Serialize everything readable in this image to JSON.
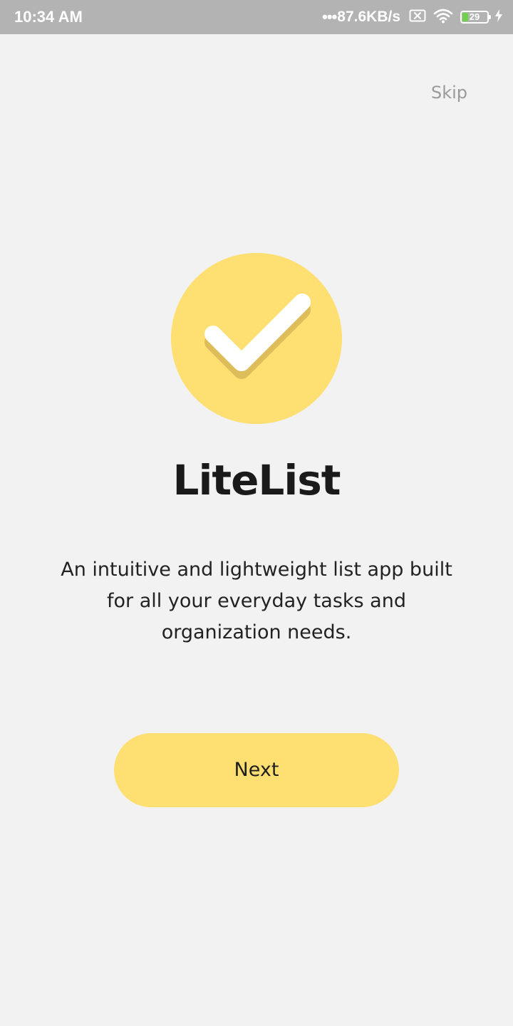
{
  "status_bar": {
    "time": "10:34 AM",
    "network_dots": "•••",
    "network_speed": "87.6KB/s",
    "battery_level": "29",
    "icons": [
      "sim-off-icon",
      "wifi-icon",
      "battery-icon",
      "charging-icon"
    ]
  },
  "onboarding": {
    "skip_label": "Skip",
    "app_name": "LiteList",
    "description": "An intuitive and lightweight list app built for all your everyday tasks and organization needs.",
    "next_label": "Next"
  },
  "colors": {
    "accent": "#fddf72",
    "background": "#f2f2f2",
    "status_bar": "#b3b3b3"
  }
}
